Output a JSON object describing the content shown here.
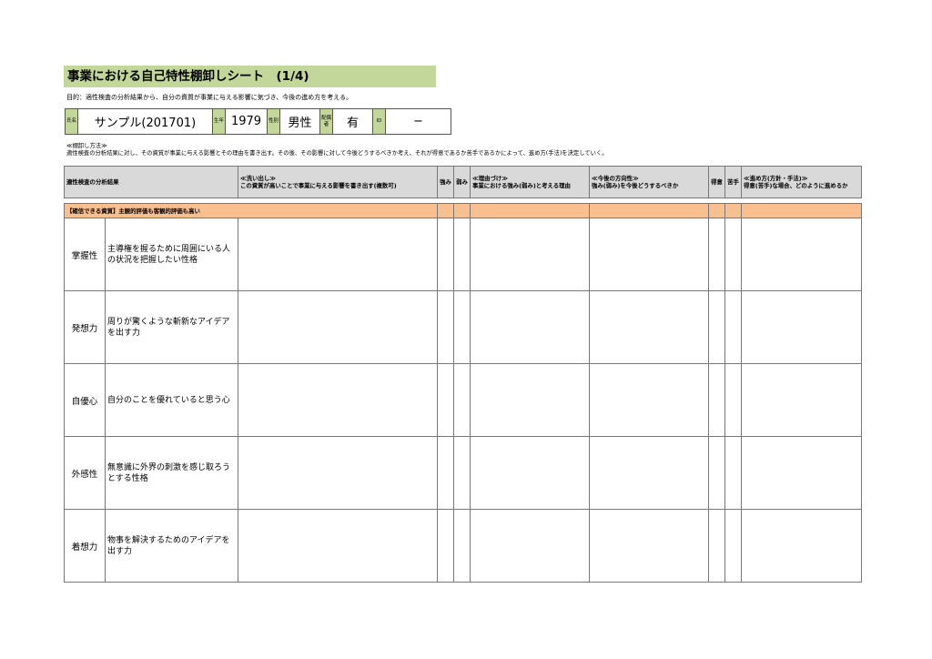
{
  "title": "事業における自己特性棚卸しシート　(1/4)",
  "purpose": "目的：適性検査の分析結果から、自分の資質が事業に与える影響に気づき、今後の進め方を考える。",
  "info": {
    "name_label": "氏名",
    "name": "サンプル(201701)",
    "birth_label": "生年",
    "birth_year": "1979",
    "gender_label": "性別",
    "gender": "男性",
    "spouse_label": "配偶者",
    "spouse": "有",
    "id_label": "ID",
    "id": "−"
  },
  "method": {
    "heading": "≪棚卸し方法≫",
    "text": "適性検査の分析結果に対し、その資質が事業に与える影響とその理由を書き出す。その後、その影響に対して今後どうするべきか考え、それが得意であるか苦手であるかによって、進め方(手法)を決定していく。"
  },
  "headers": {
    "analysis": "適性検査の分析結果",
    "writeout": "≪洗い出し≫\nこの資質が高いことで事業に与える影響を書き出す(複数可)",
    "strength": "強み",
    "weakness": "弱み",
    "reason": "≪理由づけ≫\n事業における強み(弱み)と考える理由",
    "direction": "≪今後の方向性≫\n強み(弱み)を今後どうするべきか",
    "good": "得意",
    "poor": "苦手",
    "approach": "≪進め方(方針・手法)≫\n得意(苦手)な場合、どのように進めるか"
  },
  "category": "【確信できる資質】主観的評価も客観的評価も高い",
  "rows": [
    {
      "trait": "掌握性",
      "desc": "主導権を握るために周囲にいる人の状況を把握したい性格"
    },
    {
      "trait": "発想力",
      "desc": "周りが驚くような斬新なアイデアを出す力"
    },
    {
      "trait": "自優心",
      "desc": "自分のことを優れていると思う心"
    },
    {
      "trait": "外感性",
      "desc": "無意識に外界の刺激を感じ取ろうとする性格"
    },
    {
      "trait": "着想力",
      "desc": "物事を解決するためのアイデアを出す力"
    }
  ],
  "colors": {
    "title_bg": "#c4d79b",
    "header_bg": "#d9d9d9",
    "category_bg": "#fabf8f"
  }
}
